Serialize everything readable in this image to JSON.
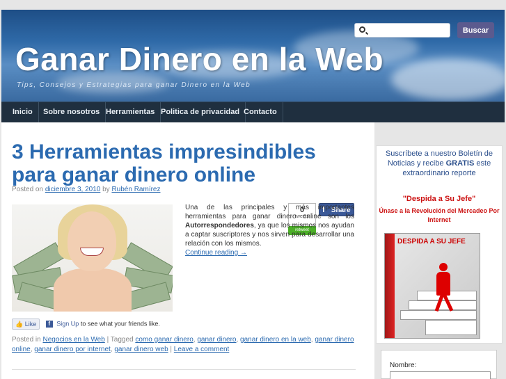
{
  "header": {
    "site_title": "Ganar Dinero en la Web",
    "tagline": "Tips, Consejos y Estrategias para ganar Dinero en la Web",
    "search_placeholder": "",
    "search_button": "Buscar"
  },
  "nav": {
    "items": [
      {
        "label": "Inicio"
      },
      {
        "label": "Sobre nosotros"
      },
      {
        "label": "Herramientas"
      },
      {
        "label": "Politica de privacidad"
      },
      {
        "label": "Contacto"
      }
    ]
  },
  "post": {
    "title": "3 Herramientas impresindibles para ganar dinero online",
    "posted_on": "Posted on",
    "date": "diciembre 3, 2010",
    "by": "by",
    "author": "Rubén Ramírez",
    "text_part1": "Una de las principales y más importantes herramientas para ganar dinero online son los",
    "text_bold": "Autorrespondedores",
    "text_part2": ", ya que los mismos nos ayudan a captar suscriptores y nos sirven para desarrollar una relación con los mismos.",
    "continue": "Continue reading →",
    "tweet_count": "0",
    "tweet_label": "tweets",
    "retweet_label": "retweet",
    "share_label": "Share",
    "like_label": "Like",
    "signup_label": "Sign Up",
    "signup_text": "to see what your friends like.",
    "posted_in": "Posted in",
    "category": "Negocios en la Web",
    "tagged": "| Tagged",
    "tags": [
      "como ganar dinero",
      "ganar dinero",
      "ganar dinero en la web",
      "ganar dinero online",
      "ganar dinero por internet",
      "ganar dinero web"
    ],
    "leave_comment": "Leave a comment"
  },
  "sidebar": {
    "promo_line1": "Suscríbete a nuestro Boletín de Noticias y recibe",
    "promo_bold": "GRATIS",
    "promo_line2": "este extraordinario reporte",
    "despida": "\"Despida a Su Jefe\"",
    "unase": "Únase a la Revolución del Mercadeo Por Internet",
    "book_title": "DESPIDA A SU JEFE",
    "form_label": "Nombre:"
  },
  "colors": {
    "accent": "#2b6ab0",
    "nav_bg": "#1f2f3f",
    "search_button": "#5b5a8e",
    "promo_red": "#cc1111"
  }
}
